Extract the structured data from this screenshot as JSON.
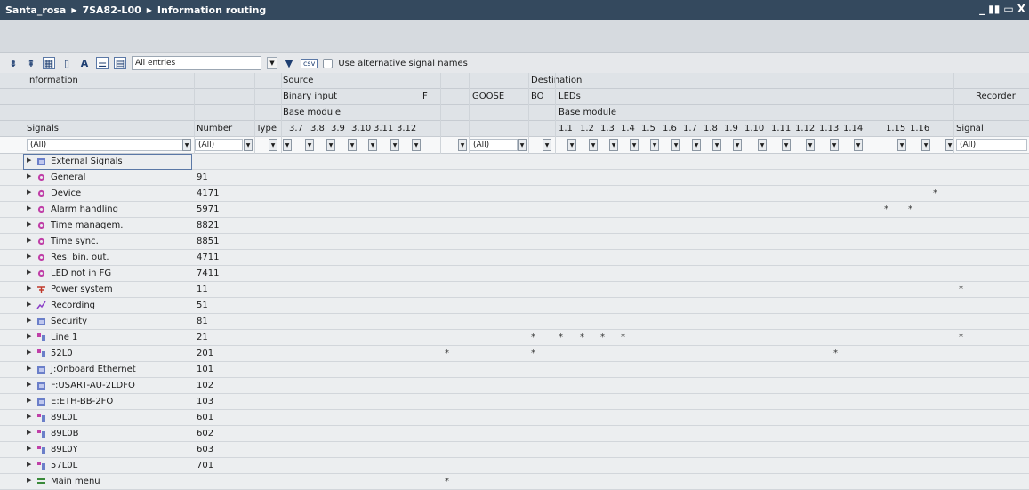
{
  "breadcrumb": [
    "Santa_rosa",
    "7SA82-L00",
    "Information routing"
  ],
  "window_controls": [
    "_",
    "▮▮",
    "▭",
    "X"
  ],
  "toolbar": {
    "filter_value": "All entries",
    "alt_names_label": "Use alternative signal names",
    "csv_label": "csv"
  },
  "header": {
    "information": "Information",
    "source": "Source",
    "destination": "Destination",
    "binary_input": "Binary input",
    "f_col": "F",
    "goose": "GOOSE",
    "bo": "BO",
    "leds": "LEDs",
    "recorder": "Recorder",
    "base_module": "Base module",
    "base_module2": "Base module",
    "signals": "Signals",
    "number": "Number",
    "type": "Type",
    "bi_cols": [
      "3.7",
      "3.8",
      "3.9",
      "3.10",
      "3.11",
      "3.12"
    ],
    "led_cols": [
      "1.1",
      "1.2",
      "1.3",
      "1.4",
      "1.5",
      "1.6",
      "1.7",
      "1.8",
      "1.9",
      "1.10",
      "1.11",
      "1.12",
      "1.13",
      "1.14",
      "1.15",
      "1.16"
    ],
    "signal": "Signal"
  },
  "filters": {
    "signals": "(All)",
    "number": "(All)",
    "f": "(All)",
    "signal": "(All)"
  },
  "rows": [
    {
      "label": "External Signals",
      "number": "",
      "icon": "folder",
      "stars": []
    },
    {
      "label": "General",
      "number": "91",
      "icon": "gear",
      "stars": []
    },
    {
      "label": "Device",
      "number": "4171",
      "icon": "gear",
      "stars": [
        "rec"
      ]
    },
    {
      "label": "Alarm handling",
      "number": "5971",
      "icon": "gear",
      "stars": [
        "1.13",
        "1.14"
      ]
    },
    {
      "label": "Time managem.",
      "number": "8821",
      "icon": "gear",
      "stars": []
    },
    {
      "label": "Time sync.",
      "number": "8851",
      "icon": "gear",
      "stars": []
    },
    {
      "label": "Res. bin. out.",
      "number": "4711",
      "icon": "gear",
      "stars": []
    },
    {
      "label": "LED not in FG",
      "number": "7411",
      "icon": "gear",
      "stars": []
    },
    {
      "label": "Power system",
      "number": "11",
      "icon": "power",
      "stars": [
        "sig"
      ]
    },
    {
      "label": "Recording",
      "number": "51",
      "icon": "rec",
      "stars": []
    },
    {
      "label": "Security",
      "number": "81",
      "icon": "folder",
      "stars": []
    },
    {
      "label": "Line 1",
      "number": "21",
      "icon": "line",
      "stars": [
        "bo",
        "1.1",
        "1.2",
        "1.3",
        "1.4",
        "sig"
      ]
    },
    {
      "label": "52L0",
      "number": "201",
      "icon": "line",
      "stars": [
        "goose",
        "bo",
        "1.11"
      ]
    },
    {
      "label": "J:Onboard Ethernet",
      "number": "101",
      "icon": "folder",
      "stars": []
    },
    {
      "label": "F:USART-AU-2LDFO",
      "number": "102",
      "icon": "folder",
      "stars": []
    },
    {
      "label": "E:ETH-BB-2FO",
      "number": "103",
      "icon": "folder",
      "stars": []
    },
    {
      "label": "89L0L",
      "number": "601",
      "icon": "line",
      "stars": []
    },
    {
      "label": "89L0B",
      "number": "602",
      "icon": "line",
      "stars": []
    },
    {
      "label": "89L0Y",
      "number": "603",
      "icon": "line",
      "stars": []
    },
    {
      "label": "57L0L",
      "number": "701",
      "icon": "line",
      "stars": []
    },
    {
      "label": "Main menu",
      "number": "",
      "icon": "menu",
      "stars": [
        "goose"
      ]
    }
  ]
}
